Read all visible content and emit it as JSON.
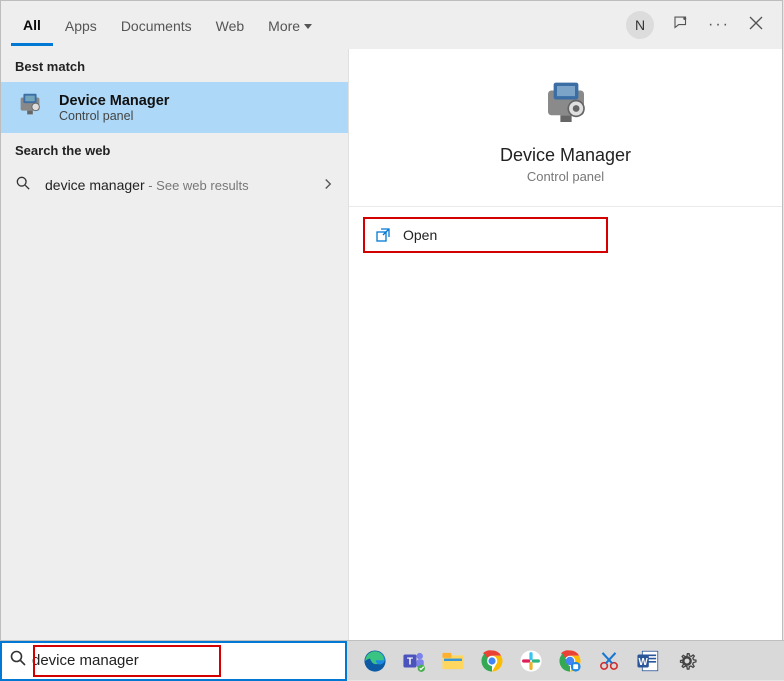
{
  "tabs": {
    "all": "All",
    "apps": "Apps",
    "documents": "Documents",
    "web": "Web",
    "more": "More"
  },
  "avatar_letter": "N",
  "best_match_label": "Best match",
  "best_match": {
    "title": "Device Manager",
    "subtitle": "Control panel"
  },
  "search_web_label": "Search the web",
  "web_result": {
    "query": "device manager",
    "hint": " - See web results"
  },
  "preview": {
    "title": "Device Manager",
    "subtitle": "Control panel"
  },
  "actions": {
    "open": "Open"
  },
  "searchbox": {
    "value": "device manager"
  }
}
